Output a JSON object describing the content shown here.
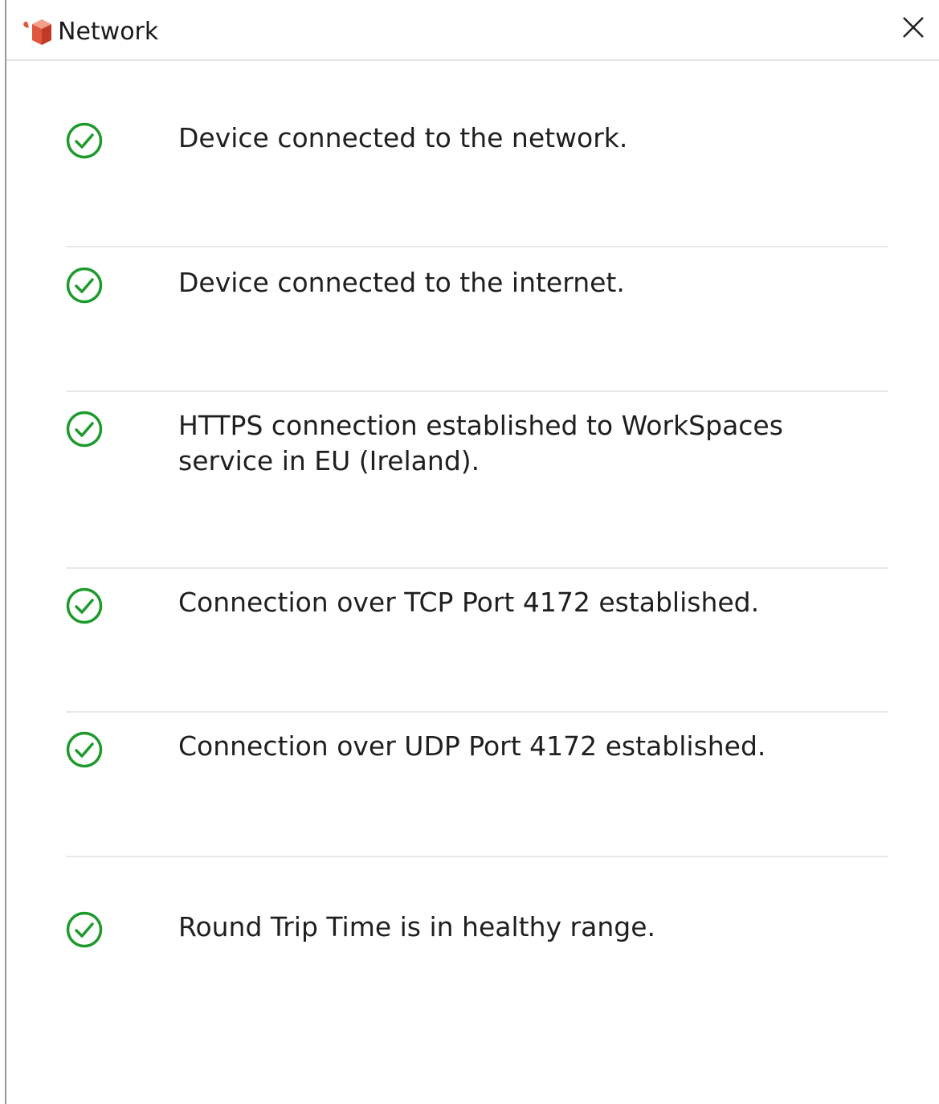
{
  "window": {
    "title": "Network",
    "app_icon": "workspaces-cube-icon",
    "close_icon": "close-icon"
  },
  "colors": {
    "success": "#1e9a2c",
    "divider": "#e6e9eb",
    "text": "#1f1f1f"
  },
  "checks": [
    {
      "status": "success",
      "icon": "check-circle-icon",
      "message": "Device connected to the network."
    },
    {
      "status": "success",
      "icon": "check-circle-icon",
      "message": "Device connected to the internet."
    },
    {
      "status": "success",
      "icon": "check-circle-icon",
      "message": "HTTPS connection established to WorkSpaces service in EU (Ireland)."
    },
    {
      "status": "success",
      "icon": "check-circle-icon",
      "message": "Connection over TCP Port 4172 established."
    },
    {
      "status": "success",
      "icon": "check-circle-icon",
      "message": "Connection over UDP Port 4172 established."
    },
    {
      "status": "success",
      "icon": "check-circle-icon",
      "message": "Round Trip Time is in healthy range."
    }
  ]
}
